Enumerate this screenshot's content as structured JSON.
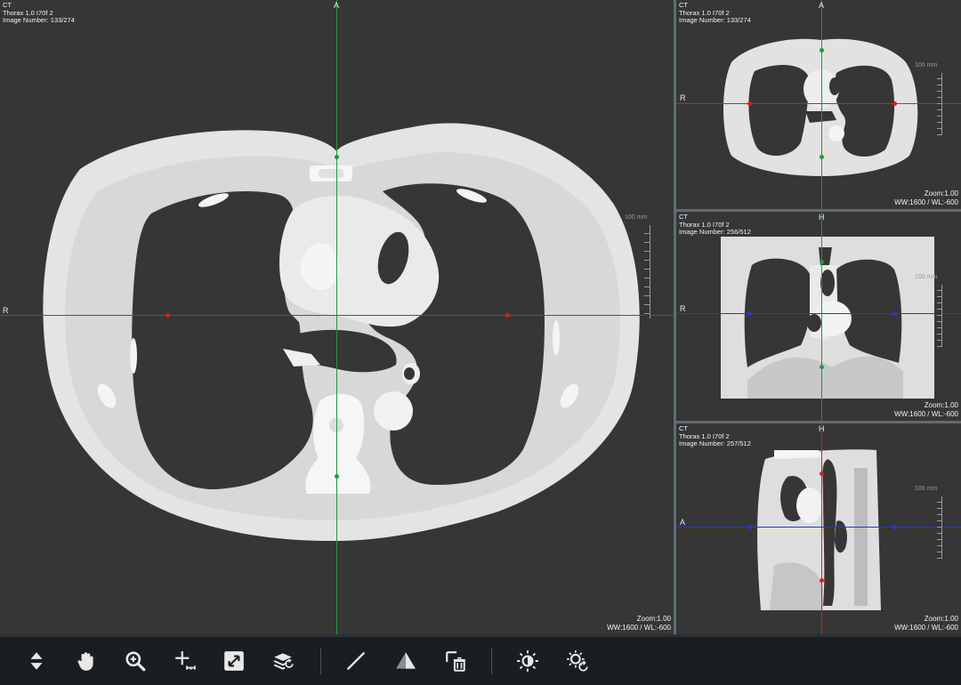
{
  "main_view": {
    "modality": "CT",
    "series": "Thorax 1.0 I70f 2",
    "image_number": "Image Number: 133/274",
    "orient_top": "A",
    "orient_left": "R",
    "scale_label": "100 mm",
    "zoom": "Zoom:1.00",
    "window": "WW:1600 / WL:-600"
  },
  "axial_view": {
    "modality": "CT",
    "series": "Thorax 1.0 I70f 2",
    "image_number": "Image Number: 133/274",
    "orient_top": "A",
    "orient_left": "R",
    "scale_label": "100 mm",
    "zoom": "Zoom:1.00",
    "window": "WW:1600 / WL:-600"
  },
  "coronal_view": {
    "modality": "CT",
    "series": "Thorax 1.0 I70f 2",
    "image_number": "Image Number: 256/512",
    "orient_top": "H",
    "orient_left": "R",
    "scale_label": "100 mm",
    "zoom": "Zoom:1.00",
    "window": "WW:1600 / WL:-600"
  },
  "sagittal_view": {
    "modality": "CT",
    "series": "Thorax 1.0 I70f 2",
    "image_number": "Image Number: 257/512",
    "orient_top": "H",
    "orient_left": "A",
    "scale_label": "100 mm",
    "zoom": "Zoom:1.00",
    "window": "WW:1600 / WL:-600"
  },
  "toolbar": {
    "tools": [
      {
        "icon": "scroll-slices-icon"
      },
      {
        "icon": "pan-hand-icon"
      },
      {
        "icon": "zoom-icon"
      },
      {
        "icon": "crosshair-measure-icon"
      },
      {
        "icon": "fit-to-window-icon"
      },
      {
        "icon": "reset-layers-icon"
      },
      {
        "icon": "line-measure-icon"
      },
      {
        "icon": "angle-measure-icon"
      },
      {
        "icon": "delete-annotations-icon"
      },
      {
        "icon": "window-level-icon"
      },
      {
        "icon": "reset-window-level-icon"
      }
    ]
  },
  "colors": {
    "viewport_bg": "#363636",
    "toolbar_bg": "#1a1e23",
    "crosshair_green": "#1f9a3c",
    "crosshair_red": "#d81e1e",
    "crosshair_blue": "#2838c8",
    "tissue": "#e6e6e6"
  }
}
